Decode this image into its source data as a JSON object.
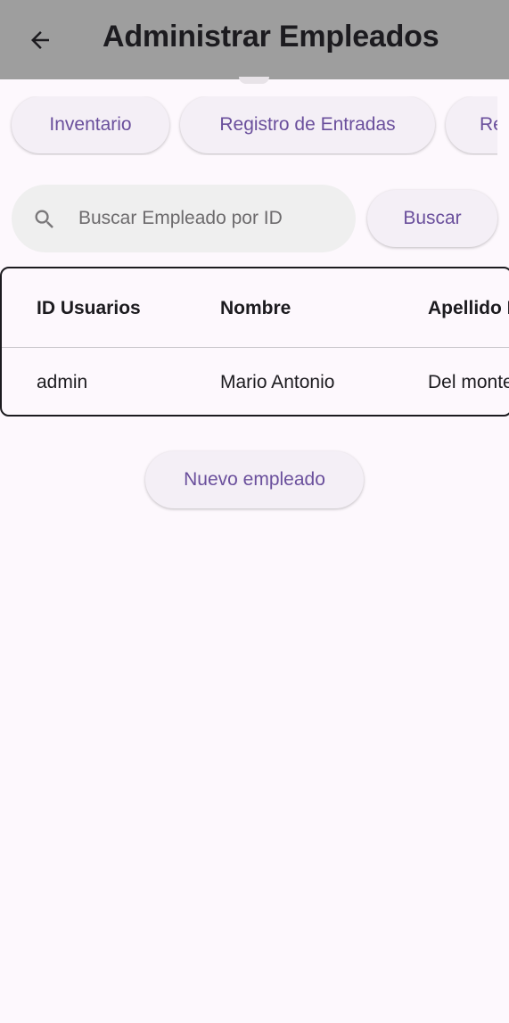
{
  "appbar": {
    "title": "Administrar Empleados",
    "back_icon": "arrow-left-icon"
  },
  "nav": {
    "items": [
      {
        "label": "Inventario"
      },
      {
        "label": "Registro de Entradas"
      },
      {
        "label": "Re"
      }
    ]
  },
  "search": {
    "placeholder": "Buscar Empleado por ID",
    "value": "",
    "icon": "search-icon",
    "button_label": "Buscar"
  },
  "table": {
    "columns": [
      "ID Usuarios",
      "Nombre",
      "Apellido P"
    ],
    "rows": [
      [
        "admin",
        "Mario Antonio",
        "Del monte"
      ]
    ]
  },
  "actions": {
    "new_employee_label": "Nuevo empleado"
  },
  "colors": {
    "appbar_bg": "#9e9e9e",
    "page_bg": "#fdf8fd",
    "accent": "#6a4f9c",
    "pill_bg": "#f4eff6",
    "search_bg": "#efefef"
  }
}
